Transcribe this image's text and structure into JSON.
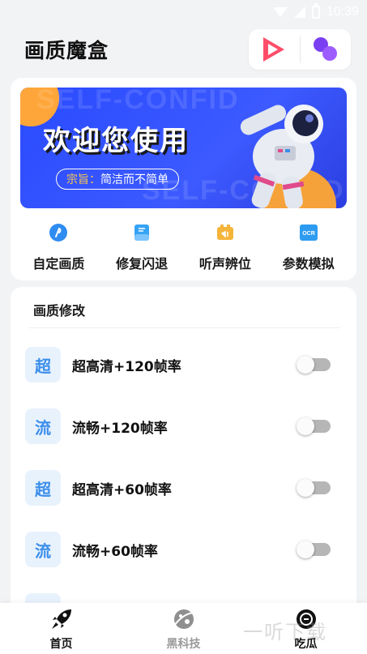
{
  "status_bar": {
    "time": "10:39"
  },
  "header": {
    "title": "画质魔盒"
  },
  "banner": {
    "title": "欢迎您使用",
    "slogan_key": "宗旨：",
    "slogan_value": "简洁而不简单",
    "bg_text": "SELF-CONFID"
  },
  "shortcuts": [
    {
      "label": "自定画质",
      "icon": "custom-quality-icon",
      "color": "#2f8cf0"
    },
    {
      "label": "修复闪退",
      "icon": "repair-icon",
      "color": "#36a3f5"
    },
    {
      "label": "听声辨位",
      "icon": "sound-locate-icon",
      "color": "#f5b43a"
    },
    {
      "label": "参数模拟",
      "icon": "ocr-icon",
      "color": "#2d9cf0"
    }
  ],
  "settings": {
    "section_title": "画质修改",
    "items": [
      {
        "badge": "超",
        "label": "超高清+120帧率",
        "enabled": false
      },
      {
        "badge": "流",
        "label": "流畅+120帧率",
        "enabled": false
      },
      {
        "badge": "超",
        "label": "超高清+60帧率",
        "enabled": false
      },
      {
        "badge": "流",
        "label": "流畅+60帧率",
        "enabled": false
      }
    ]
  },
  "bottom_nav": [
    {
      "label": "首页",
      "icon": "rocket-icon",
      "active": true
    },
    {
      "label": "黑科技",
      "icon": "planet-icon",
      "active": false
    },
    {
      "label": "吃瓜",
      "icon": "melon-icon",
      "active": false
    }
  ],
  "watermark": "一听下载"
}
